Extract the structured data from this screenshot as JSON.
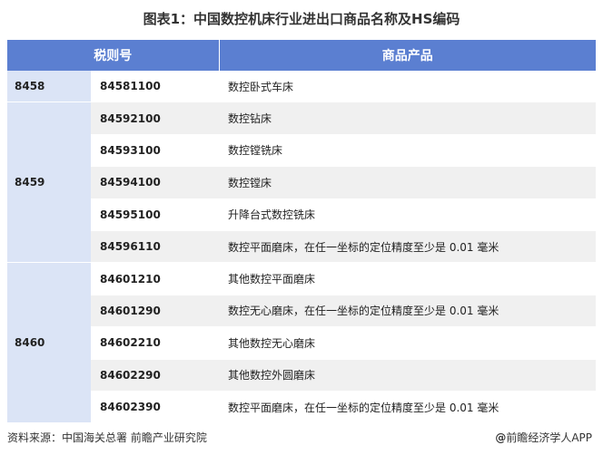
{
  "title": "图表1：中国数控机床行业进出口商品名称及HS编码",
  "headers": {
    "col1": "税则号",
    "col2": "商品产品"
  },
  "groups": [
    {
      "code": "8458"
    },
    {
      "code": "8459"
    },
    {
      "code": "8460"
    }
  ],
  "rows": [
    {
      "code": "84581100",
      "product": "数控卧式车床"
    },
    {
      "code": "84592100",
      "product": "数控钻床"
    },
    {
      "code": "84593100",
      "product": "数控镗铣床"
    },
    {
      "code": "84594100",
      "product": "数控镗床"
    },
    {
      "code": "84595100",
      "product": "升降台式数控铣床"
    },
    {
      "code": "84596110",
      "product": "数控平面磨床，在任一坐标的定位精度至少是 0.01 毫米"
    },
    {
      "code": "84601210",
      "product": "其他数控平面磨床"
    },
    {
      "code": "84601290",
      "product": "数控无心磨床，在任一坐标的定位精度至少是 0.01 毫米"
    },
    {
      "code": "84602210",
      "product": "其他数控无心磨床"
    },
    {
      "code": "84602290",
      "product": "其他数控外圆磨床"
    },
    {
      "code": "84602390",
      "product": "数控平面磨床，在任一坐标的定位精度至少是 0.01 毫米"
    }
  ],
  "footer": {
    "source": "资料来源：中国海关总署 前瞻产业研究院",
    "at_symbol": "@",
    "brand": "前瞻经济学人APP"
  }
}
